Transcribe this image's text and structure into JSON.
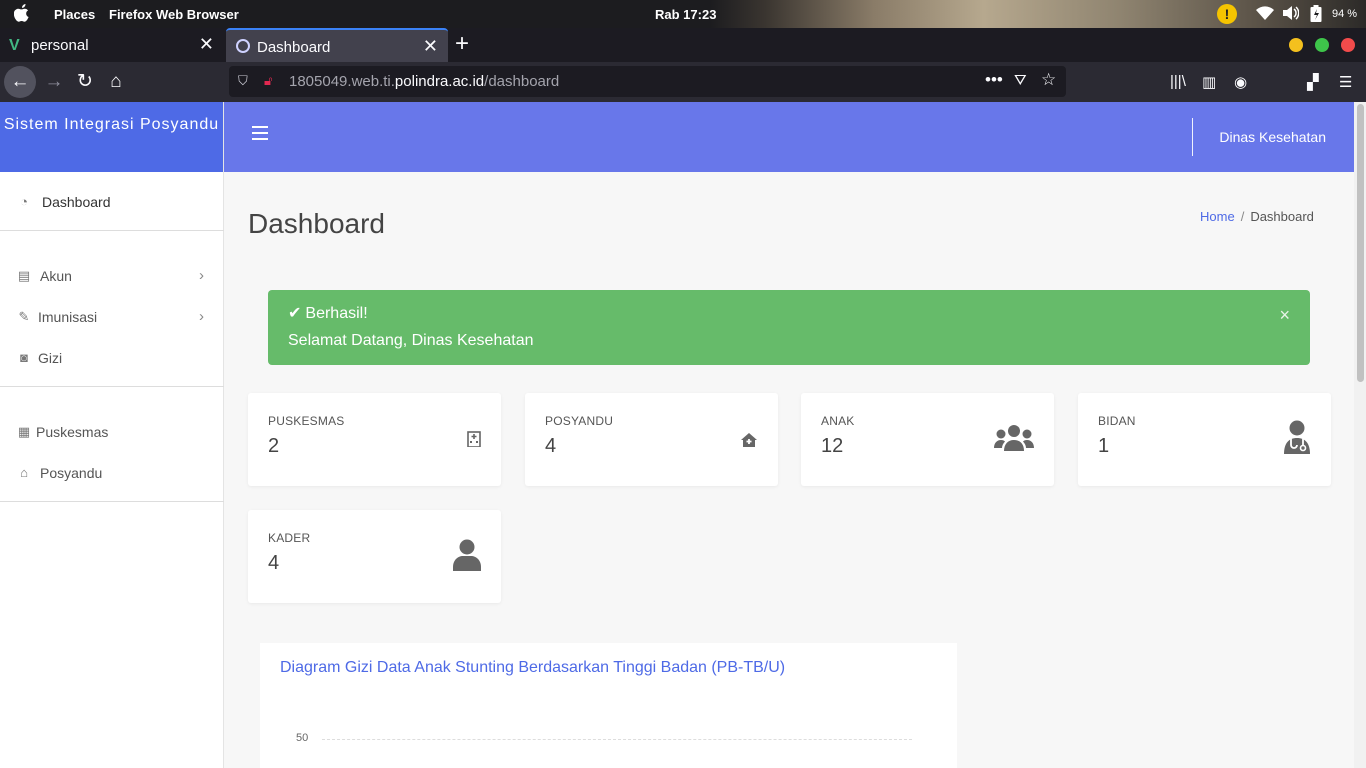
{
  "os": {
    "places": "Places",
    "app_name": "Firefox Web Browser",
    "clock": "Rab 17:23",
    "battery": "94 %"
  },
  "tabs": [
    {
      "title": "personal",
      "icon": "vue-icon"
    },
    {
      "title": "Dashboard",
      "icon": "globe-icon",
      "active": true
    }
  ],
  "browser": {
    "url_prefix": "1805049.web.ti.",
    "url_domain": "polindra.ac.id",
    "url_path": "/dashboard"
  },
  "sidebar": {
    "brand": "Sistem Integrasi Posyandu",
    "items": [
      {
        "label": "Dashboard",
        "icon": "dashboard-icon"
      },
      {
        "label": "Akun",
        "icon": "id-card-icon",
        "submenu": true
      },
      {
        "label": "Imunisasi",
        "icon": "syringe-icon",
        "submenu": true
      },
      {
        "label": "Gizi",
        "icon": "scale-icon"
      },
      {
        "label": "Puskesmas",
        "icon": "hospital-icon"
      },
      {
        "label": "Posyandu",
        "icon": "home-icon"
      }
    ]
  },
  "header": {
    "user": "Dinas Kesehatan"
  },
  "page": {
    "title": "Dashboard",
    "breadcrumb": {
      "home": "Home",
      "current": "Dashboard"
    }
  },
  "alert": {
    "title": "Berhasil!",
    "message": "Selamat Datang, Dinas Kesehatan",
    "close": "×"
  },
  "stats": [
    {
      "label": "PUSKESMAS",
      "value": "2",
      "icon": "hospital-icon"
    },
    {
      "label": "POSYANDU",
      "value": "4",
      "icon": "clinic-home-icon"
    },
    {
      "label": "ANAK",
      "value": "12",
      "icon": "users-icon"
    },
    {
      "label": "BIDAN",
      "value": "1",
      "icon": "doctor-icon"
    },
    {
      "label": "KADER",
      "value": "4",
      "icon": "user-icon"
    }
  ],
  "chart": {
    "title": "Diagram Gizi Data Anak Stunting Berdasarkan Tinggi Badan (PB-TB/U)",
    "tick_top": "50"
  },
  "colors": {
    "sidebar_brand": "#4e6ae6",
    "header": "#6877ea",
    "alert_success": "#66bb6a",
    "link": "#4e6ae6"
  }
}
